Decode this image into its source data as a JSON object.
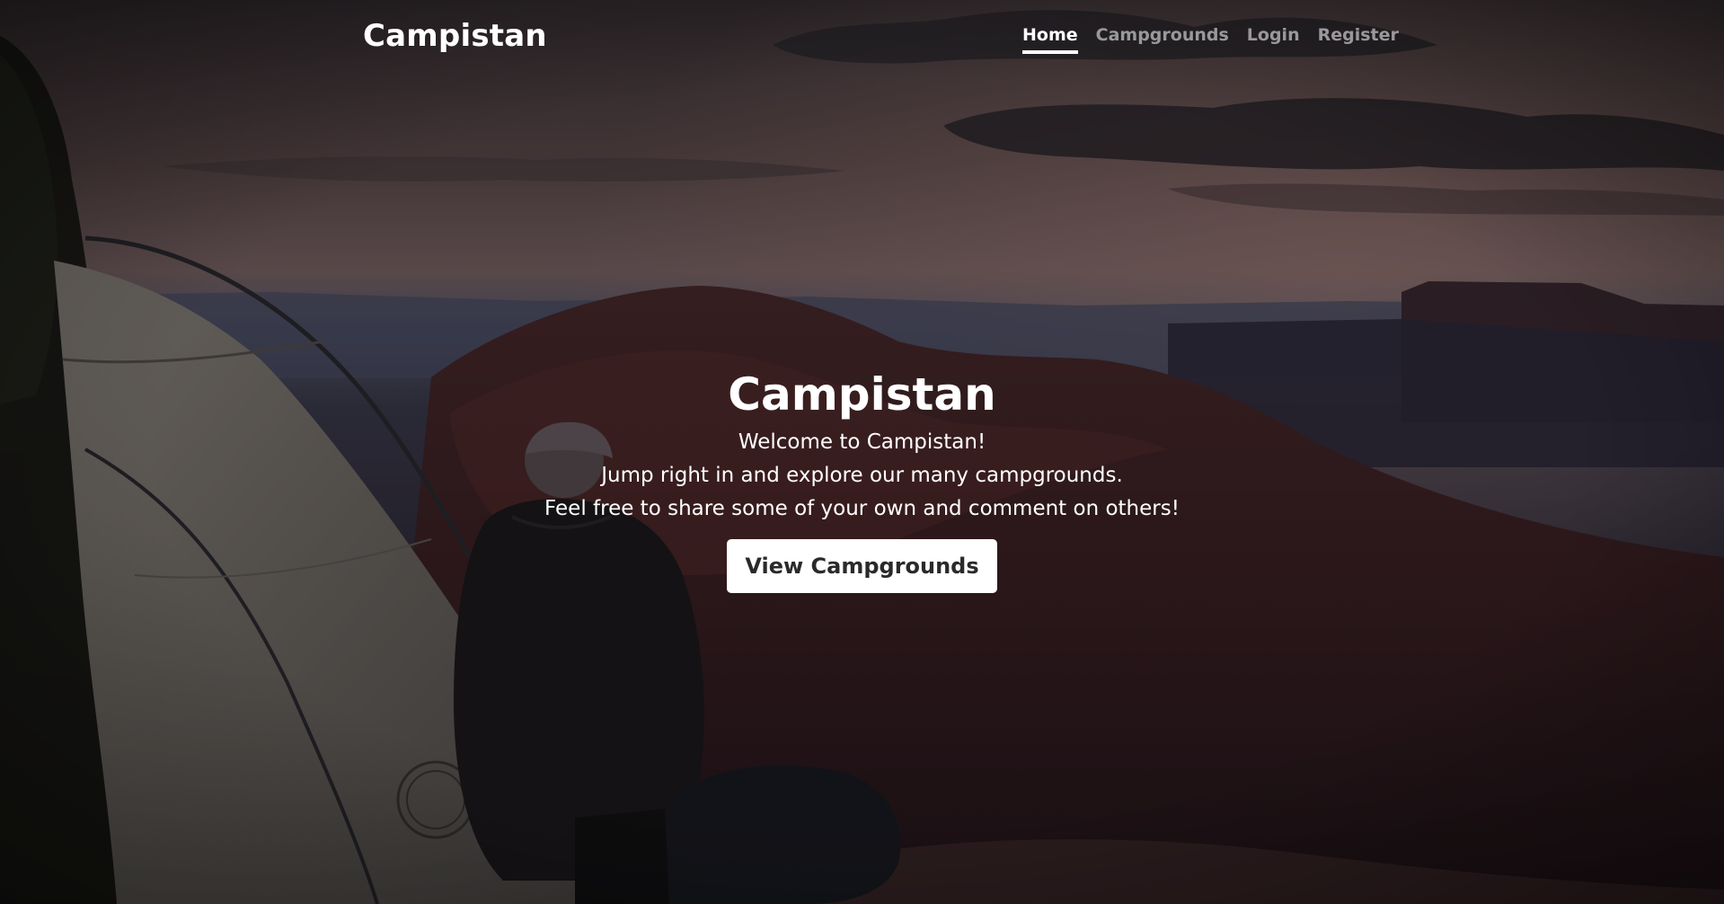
{
  "navbar": {
    "brand": "Campistan",
    "links": [
      {
        "label": "Home",
        "active": true
      },
      {
        "label": "Campgrounds",
        "active": false
      },
      {
        "label": "Login",
        "active": false
      },
      {
        "label": "Register",
        "active": false
      }
    ]
  },
  "hero": {
    "title": "Campistan",
    "lines": [
      "Welcome to Campistan!",
      "Jump right in and explore our many campgrounds.",
      "Feel free to share some of your own and comment on others!"
    ],
    "button_label": "View Campgrounds"
  },
  "colors": {
    "accent": "#ffffff",
    "button_text": "#2a2a2a",
    "sky_top": "#3d3438",
    "horizon": "#8a7070",
    "ground": "#2a1a1e"
  }
}
